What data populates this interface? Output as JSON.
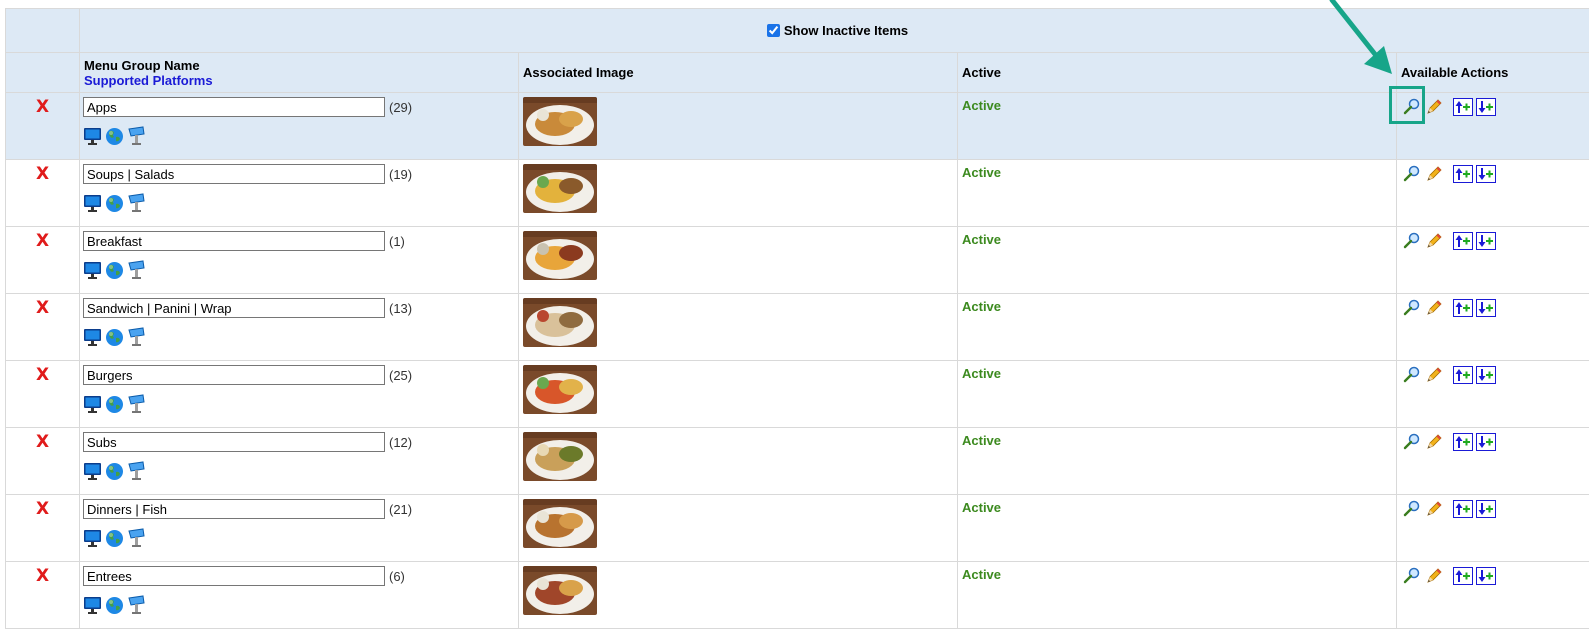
{
  "header": {
    "show_inactive_label": "Show Inactive Items",
    "show_inactive_checked": true,
    "col_name": "Menu Group Name",
    "col_platforms": "Supported Platforms",
    "col_image": "Associated Image",
    "col_active": "Active",
    "col_actions": "Available Actions"
  },
  "rows": [
    {
      "name": "Apps",
      "count": "(29)",
      "status": "Active",
      "selected": true
    },
    {
      "name": "Soups | Salads",
      "count": "(19)",
      "status": "Active"
    },
    {
      "name": "Breakfast",
      "count": "(1)",
      "status": "Active"
    },
    {
      "name": "Sandwich | Panini | Wrap",
      "count": "(13)",
      "status": "Active"
    },
    {
      "name": "Burgers",
      "count": "(25)",
      "status": "Active"
    },
    {
      "name": "Subs",
      "count": "(12)",
      "status": "Active"
    },
    {
      "name": "Dinners | Fish",
      "count": "(21)",
      "status": "Active"
    },
    {
      "name": "Entrees",
      "count": "(6)",
      "status": "Active"
    }
  ],
  "delete_symbol": "X",
  "colors": {
    "header_bg": "#dde9f5",
    "active_text": "#3c8a1f",
    "delete_red": "#e01b1b",
    "link_blue": "#1a1ad6",
    "highlight": "#17a589"
  },
  "icons": {
    "platforms": [
      "monitor-icon",
      "globe-icon",
      "kiosk-icon"
    ],
    "actions": [
      "magnifier-icon",
      "pencil-icon",
      "move-up-icon",
      "move-down-icon"
    ]
  }
}
